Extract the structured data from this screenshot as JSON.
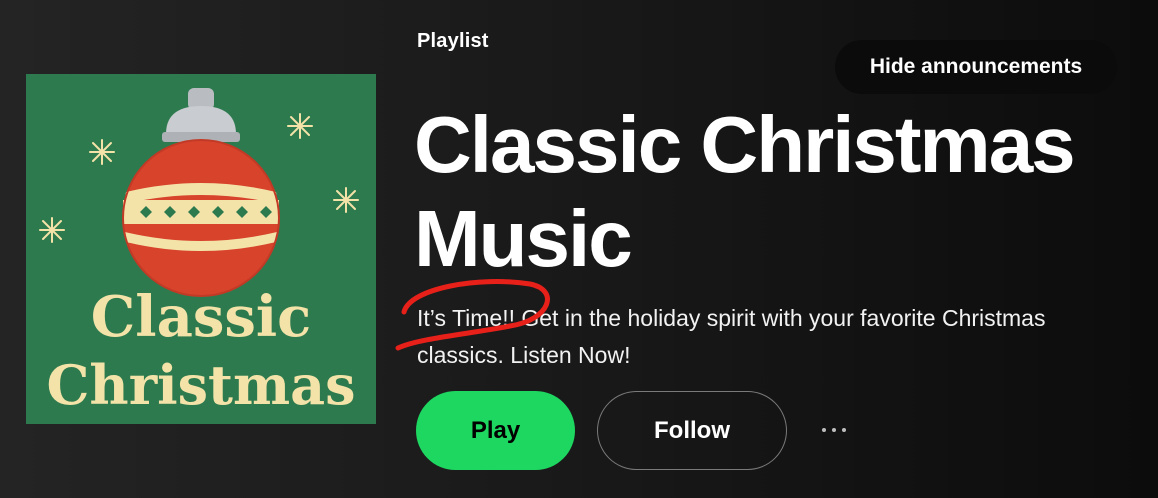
{
  "playlist": {
    "type_label": "Playlist",
    "title": "Classic Christmas Music",
    "description": "It’s Time!! Get in the holiday spirit with your favorite Christmas classics. Listen Now!",
    "cover": {
      "line1": "Classic",
      "line2": "Christmas",
      "background_color": "#2e7a4f"
    }
  },
  "buttons": {
    "hide_announcements": "Hide announcements",
    "play": "Play",
    "follow": "Follow",
    "more_icon": "more-options-icon"
  },
  "colors": {
    "accent_green": "#1ed760",
    "annotation_red": "#e8201a",
    "ornament_red": "#d8432c",
    "cream": "#f3e3a8"
  }
}
